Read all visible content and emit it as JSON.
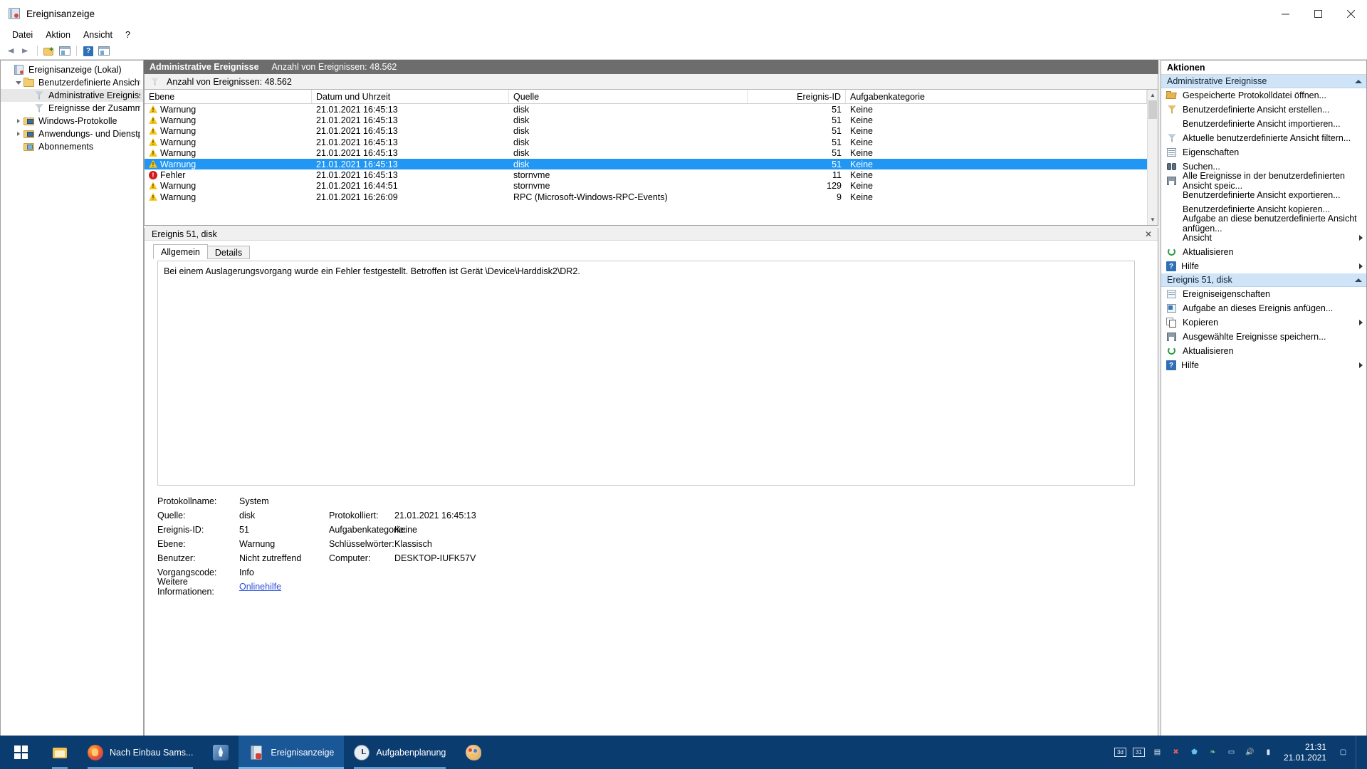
{
  "window": {
    "title": "Ereignisanzeige",
    "icon": "event-viewer-icon",
    "minimize": "–",
    "maximize": "□",
    "close": "✕"
  },
  "menubar": {
    "items": [
      "Datei",
      "Aktion",
      "Ansicht",
      "?"
    ]
  },
  "toolbar": {
    "back": "back-arrow",
    "forward": "forward-arrow",
    "new_view": "new-custom-view",
    "show_pane": "show-action-pane",
    "help": "?",
    "properties": "properties-window"
  },
  "tree": {
    "items": [
      {
        "label": "Ereignisanzeige (Lokal)",
        "icon": "event-viewer-icon",
        "indent": 0,
        "twisty": "none",
        "selected": false
      },
      {
        "label": "Benutzerdefinierte Ansichten",
        "icon": "folder-icon",
        "indent": 1,
        "twisty": "open",
        "selected": false
      },
      {
        "label": "Administrative Ereignisse",
        "icon": "funnel-icon",
        "indent": 2,
        "twisty": "none",
        "selected": true
      },
      {
        "label": "Ereignisse der Zusammenfassu",
        "icon": "funnel-icon",
        "indent": 2,
        "twisty": "none",
        "selected": false
      },
      {
        "label": "Windows-Protokolle",
        "icon": "folder-pc-icon",
        "indent": 1,
        "twisty": "closed",
        "selected": false
      },
      {
        "label": "Anwendungs- und Dienstprotoko",
        "icon": "folder-pc-icon",
        "indent": 1,
        "twisty": "closed",
        "selected": false
      },
      {
        "label": "Abonnements",
        "icon": "subscription-icon",
        "indent": 1,
        "twisty": "none",
        "selected": false
      }
    ]
  },
  "center": {
    "header_title": "Administrative Ereignisse",
    "header_count": "Anzahl von Ereignissen: 48.562",
    "filter_summary": "Anzahl von Ereignissen: 48.562",
    "columns": [
      "Ebene",
      "Datum und Uhrzeit",
      "Quelle",
      "Ereignis-ID",
      "Aufgabenkategorie"
    ],
    "rows": [
      {
        "level": "Warnung",
        "level_icon": "warning-icon",
        "datetime": "21.01.2021 16:45:13",
        "source": "disk",
        "event_id": "51",
        "category": "Keine",
        "selected": false
      },
      {
        "level": "Warnung",
        "level_icon": "warning-icon",
        "datetime": "21.01.2021 16:45:13",
        "source": "disk",
        "event_id": "51",
        "category": "Keine",
        "selected": false
      },
      {
        "level": "Warnung",
        "level_icon": "warning-icon",
        "datetime": "21.01.2021 16:45:13",
        "source": "disk",
        "event_id": "51",
        "category": "Keine",
        "selected": false
      },
      {
        "level": "Warnung",
        "level_icon": "warning-icon",
        "datetime": "21.01.2021 16:45:13",
        "source": "disk",
        "event_id": "51",
        "category": "Keine",
        "selected": false
      },
      {
        "level": "Warnung",
        "level_icon": "warning-icon",
        "datetime": "21.01.2021 16:45:13",
        "source": "disk",
        "event_id": "51",
        "category": "Keine",
        "selected": false
      },
      {
        "level": "Warnung",
        "level_icon": "warning-icon",
        "datetime": "21.01.2021 16:45:13",
        "source": "disk",
        "event_id": "51",
        "category": "Keine",
        "selected": true
      },
      {
        "level": "Fehler",
        "level_icon": "error-icon",
        "datetime": "21.01.2021 16:45:13",
        "source": "stornvme",
        "event_id": "11",
        "category": "Keine",
        "selected": false
      },
      {
        "level": "Warnung",
        "level_icon": "warning-icon",
        "datetime": "21.01.2021 16:44:51",
        "source": "stornvme",
        "event_id": "129",
        "category": "Keine",
        "selected": false
      },
      {
        "level": "Warnung",
        "level_icon": "warning-icon",
        "datetime": "21.01.2021 16:26:09",
        "source": "RPC (Microsoft-Windows-RPC-Events)",
        "event_id": "9",
        "category": "Keine",
        "selected": false
      }
    ]
  },
  "detail": {
    "title": "Ereignis 51, disk",
    "close": "✕",
    "tabs": [
      {
        "label": "Allgemein",
        "active": true
      },
      {
        "label": "Details",
        "active": false
      }
    ],
    "message": "Bei einem Auslagerungsvorgang wurde ein Fehler festgestellt. Betroffen ist Gerät \\Device\\Harddisk2\\DR2.",
    "fields": {
      "protokollname_label": "Protokollname:",
      "protokollname_value": "System",
      "quelle_label": "Quelle:",
      "quelle_value": "disk",
      "protokolliert_label": "Protokolliert:",
      "protokolliert_value": "21.01.2021 16:45:13",
      "ereignis_id_label": "Ereignis-ID:",
      "ereignis_id_value": "51",
      "aufgabenkategorie_label": "Aufgabenkategorie:",
      "aufgabenkategorie_value": "Keine",
      "ebene_label": "Ebene:",
      "ebene_value": "Warnung",
      "schluesselwoerter_label": "Schlüsselwörter:",
      "schluesselwoerter_value": "Klassisch",
      "benutzer_label": "Benutzer:",
      "benutzer_value": "Nicht zutreffend",
      "computer_label": "Computer:",
      "computer_value": "DESKTOP-IUFK57V",
      "vorgangscode_label": "Vorgangscode:",
      "vorgangscode_value": "Info",
      "weitere_label": "Weitere Informationen:",
      "weitere_value": "Onlinehilfe"
    }
  },
  "actions": {
    "header": "Aktionen",
    "groups": [
      {
        "title": "Administrative Ereignisse",
        "items": [
          {
            "label": "Gespeicherte Protokolldatei öffnen...",
            "icon": "open-folder-icon",
            "submenu": false
          },
          {
            "label": "Benutzerdefinierte Ansicht erstellen...",
            "icon": "funnel-gold-icon",
            "submenu": false
          },
          {
            "label": "Benutzerdefinierte Ansicht importieren...",
            "icon": "blank-icon",
            "submenu": false
          },
          {
            "label": "Aktuelle benutzerdefinierte Ansicht filtern...",
            "icon": "funnel-icon",
            "submenu": false
          },
          {
            "label": "Eigenschaften",
            "icon": "properties-icon",
            "submenu": false
          },
          {
            "label": "Suchen...",
            "icon": "binoculars-icon",
            "submenu": false
          },
          {
            "label": "Alle Ereignisse in der benutzerdefinierten Ansicht speic...",
            "icon": "save-icon",
            "submenu": false
          },
          {
            "label": "Benutzerdefinierte Ansicht exportieren...",
            "icon": "blank-icon",
            "submenu": false
          },
          {
            "label": "Benutzerdefinierte Ansicht kopieren...",
            "icon": "blank-icon",
            "submenu": false
          },
          {
            "label": "Aufgabe an diese benutzerdefinierte Ansicht anfügen...",
            "icon": "blank-icon",
            "submenu": false
          },
          {
            "label": "Ansicht",
            "icon": "blank-icon",
            "submenu": true
          },
          {
            "label": "Aktualisieren",
            "icon": "refresh-icon",
            "submenu": false
          },
          {
            "label": "Hilfe",
            "icon": "help-icon",
            "submenu": true
          }
        ]
      },
      {
        "title": "Ereignis 51, disk",
        "items": [
          {
            "label": "Ereigniseigenschaften",
            "icon": "event-properties-icon",
            "submenu": false
          },
          {
            "label": "Aufgabe an dieses Ereignis anfügen...",
            "icon": "task-icon",
            "submenu": false
          },
          {
            "label": "Kopieren",
            "icon": "copy-icon",
            "submenu": true
          },
          {
            "label": "Ausgewählte Ereignisse speichern...",
            "icon": "save-icon",
            "submenu": false
          },
          {
            "label": "Aktualisieren",
            "icon": "refresh-icon",
            "submenu": false
          },
          {
            "label": "Hilfe",
            "icon": "help-icon",
            "submenu": true
          }
        ]
      }
    ]
  },
  "taskbar": {
    "start": "start-button",
    "items": [
      {
        "label": "",
        "icon": "file-explorer-icon",
        "state": "open"
      },
      {
        "label": "Nach Einbau Sams...",
        "icon": "firefox-icon",
        "state": "open"
      },
      {
        "label": "",
        "icon": "rocket-icon",
        "state": "none"
      },
      {
        "label": "Ereignisanzeige",
        "icon": "event-viewer-icon",
        "state": "active"
      },
      {
        "label": "Aufgabenplanung",
        "icon": "clock-icon",
        "state": "open"
      },
      {
        "label": "",
        "icon": "paint-icon",
        "state": "none"
      }
    ],
    "tray": {
      "icons": [
        "3d-icon",
        "31-icon",
        "document-icon",
        "red-x-icon",
        "shield-icon",
        "leaf-icon",
        "monitor-icon",
        "speaker-icon",
        "network-icon"
      ],
      "time": "21:31",
      "date": "21.01.2021",
      "notification": "notification-icon"
    }
  },
  "colors": {
    "selection": "#2196f3",
    "header_bar": "#6d6d6d",
    "group_header": "#cfe4f7",
    "taskbar": "#0b3c70",
    "link": "#2a4fd7"
  }
}
